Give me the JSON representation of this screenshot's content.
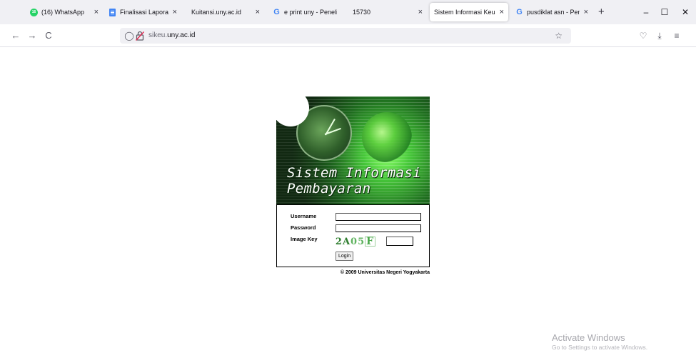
{
  "browser": {
    "tabs": [
      {
        "label": "(16) WhatsApp",
        "icon": "whatsapp-icon",
        "active": false
      },
      {
        "label": "Finalisasi Laporan D",
        "icon": "google-docs-icon",
        "active": false
      },
      {
        "label": "Kuitansi.uny.ac.id",
        "icon": "none",
        "active": false
      },
      {
        "label": "e print uny - Peneli",
        "icon": "google-icon",
        "active": false
      },
      {
        "label": "15730",
        "icon": "none",
        "active": false
      },
      {
        "label": "Sistem Informasi Keuan",
        "icon": "none",
        "active": true
      },
      {
        "label": "pusdiklat asn - Pen",
        "icon": "google-icon",
        "active": false
      }
    ],
    "tab_close_glyph": "×",
    "new_tab_glyph": "+",
    "window_controls": {
      "minimize": "–",
      "maximize": "☐",
      "close": "✕"
    },
    "nav": {
      "back": "←",
      "forward": "→",
      "reload": "C"
    },
    "url": {
      "prefix": "sikeu.",
      "domain": "uny.ac.id"
    },
    "toolbar_icons": {
      "bookmark": "☆",
      "pocket": "♡",
      "downloads": "⤓",
      "menu": "≡"
    }
  },
  "page": {
    "banner": {
      "title_line1": "Sistem Informasi",
      "title_line2": "Pembayaran"
    },
    "form": {
      "username_label": "Username",
      "password_label": "Password",
      "imagekey_label": "Image Key",
      "captcha": {
        "c1": "2A",
        "c2": "05",
        "c3": "F"
      },
      "login_label": "Login"
    },
    "copyright": "© 2009 Universitas Negeri Yogyakarta"
  },
  "watermark": {
    "line1": "Activate Windows",
    "line2": "Go to Settings to activate Windows."
  },
  "colors": {
    "tabstrip_bg": "#f0f0f4",
    "banner_green": "#47c83a",
    "captcha_green": "#2e7d2e"
  }
}
